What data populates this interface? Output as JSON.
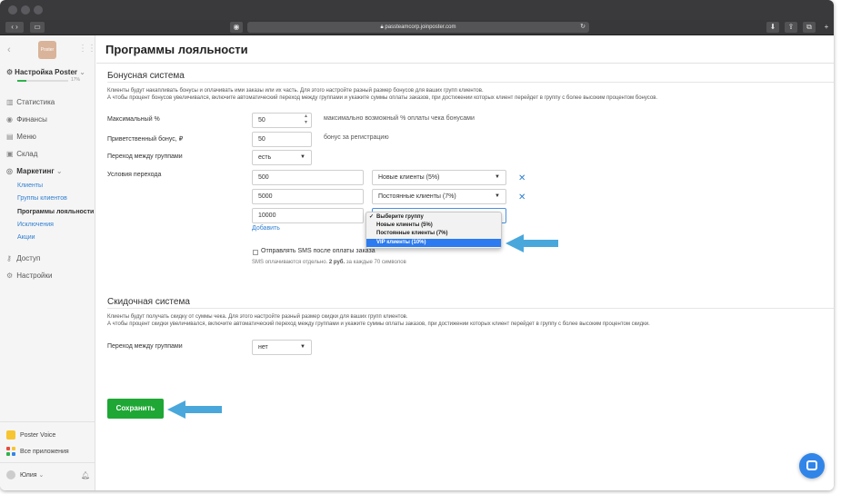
{
  "browser": {
    "url": "passteamcorp.joinposter.com"
  },
  "sidebar": {
    "logo_text": "Poster",
    "account": "Настройка Poster",
    "progress_label": "17%",
    "progress_fraction": 0.17,
    "nav": [
      {
        "label": "Статистика",
        "icon": "chart-icon"
      },
      {
        "label": "Финансы",
        "icon": "coin-icon"
      },
      {
        "label": "Меню",
        "icon": "menu-icon"
      },
      {
        "label": "Склад",
        "icon": "box-icon"
      },
      {
        "label": "Маркетинг",
        "icon": "target-icon"
      }
    ],
    "marketing_sub": [
      "Клиенты",
      "Группы клиентов",
      "Программы лояльности",
      "Исключения",
      "Акции"
    ],
    "nav_bottom": [
      {
        "label": "Доступ",
        "icon": "key-icon"
      },
      {
        "label": "Настройки",
        "icon": "gear-icon"
      }
    ],
    "poster_voice": "Poster Voice",
    "all_apps": "Все приложения",
    "user": "Юлия"
  },
  "page": {
    "title": "Программы лояльности"
  },
  "bonus": {
    "title": "Бонусная система",
    "desc_1": "Клиенты будут накапливать бонусы и оплачивать ими заказы или их часть. Для этого настройте разный размер бонусов для ваших групп клиентов.",
    "desc_2": "А чтобы процент бонусов увеличивался, включите автоматический переход между группами и укажите суммы оплаты заказов, при достижении которых клиент перейдет в группу с более высоким процентом бонусов.",
    "max_label": "Максимальный %",
    "max_value": "50",
    "max_hint": "максимально возможный % оплаты чека бонусами",
    "welcome_label": "Приветственный бонус, ₽",
    "welcome_value": "50",
    "welcome_hint": "бонус за регистрацию",
    "transition_label": "Переход между группами",
    "transition_value": "есть",
    "conditions_label": "Условия перехода",
    "conditions": [
      {
        "amount": "500",
        "group": "Новые клиенты (5%)"
      },
      {
        "amount": "5000",
        "group": "Постоянные клиенты (7%)"
      },
      {
        "amount": "10000",
        "group": ""
      }
    ],
    "add_link": "Добавить",
    "sms_label": "Отправлять SMS после оплаты заказа",
    "sms_note_pre": "SMS оплачиваются отдельно.",
    "sms_note_price": "2 руб.",
    "sms_note_post": "за каждые 70 символов"
  },
  "dropdown": {
    "options": [
      "Выберите группу",
      "Новые клиенты (5%)",
      "Постоянные клиенты (7%)",
      "VIP клиенты (10%)"
    ],
    "checked_index": 0,
    "highlighted_index": 3
  },
  "discount": {
    "title": "Скидочная система",
    "desc_1": "Клиенты будут получать скидку от суммы чека. Для этого настройте разный размер скидки для ваших групп клиентов.",
    "desc_2": "А чтобы процент скидки увеличивался, включите автоматический переход между группами и укажите суммы оплаты заказов, при достижении которых клиент перейдет в группу с более высоким процентом скидки.",
    "transition_label": "Переход между группами",
    "transition_value": "нет"
  },
  "save_label": "Сохранить",
  "colors": {
    "accent": "#1ea735",
    "link": "#2f7fd1",
    "highlight": "#2c7bf0",
    "arrow": "#49a7dc"
  }
}
